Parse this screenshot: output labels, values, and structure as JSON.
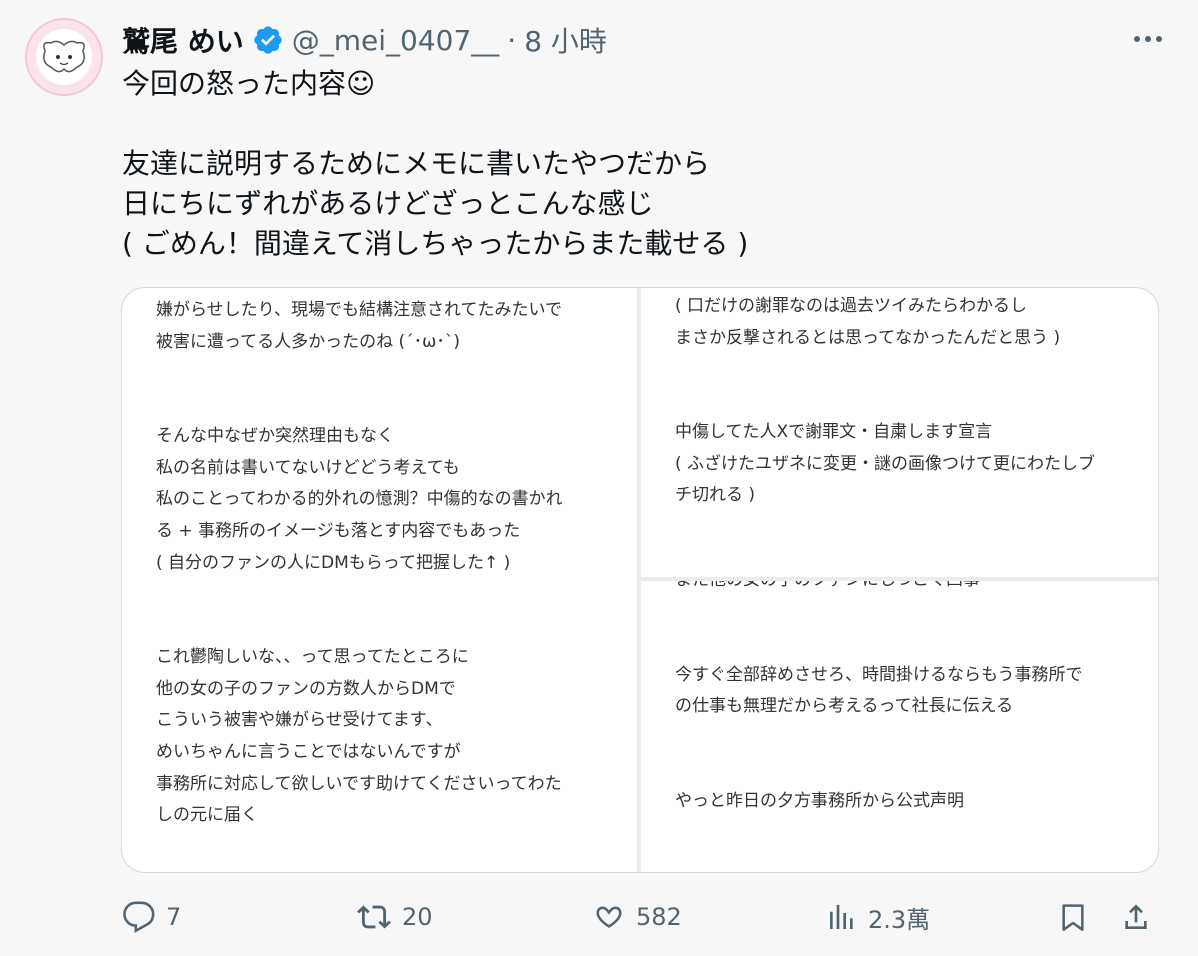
{
  "post": {
    "display_name": "鷲尾 めい",
    "handle": "@_mei_0407__",
    "separator": "·",
    "time": "8 小時",
    "lines": [
      "今回の怒った内容☺︎",
      "友達に説明するためにメモに書いたやつだから",
      "日にちにずれがあるけどざっとこんな感じ",
      "( ごめん！間違えて消しちゃったからまた載せる )"
    ]
  },
  "media": {
    "left": {
      "paragraphs": [
        [
          "嫌がらせしたり、現場でも結構注意されてたみたいで",
          "被害に遭ってる人多かったのね (´･ω･`)"
        ],
        [
          "そんな中なぜか突然理由もなく",
          "私の名前は書いてないけどどう考えても",
          "私のことってわかる的外れの憶測？中傷的なの書かれ",
          "る + 事務所のイメージも落とす内容でもあった",
          "( 自分のファンの人にDMもらって把握した↑ )"
        ],
        [
          "これ鬱陶しいな、、って思ってたところに",
          "他の女の子のファンの方数人からDMで",
          "こういう被害や嫌がらせ受けてます、",
          "めいちゃんに言うことではないんですが",
          "事務所に対応して欲しいです助けてくださいってわた",
          "しの元に届く"
        ]
      ]
    },
    "right_top": {
      "paragraphs": [
        [
          "( 口だけの謝罪なのは過去ツイみたらわかるし",
          "まさか反撃されるとは思ってなかったんだと思う )"
        ],
        [
          "中傷してた人Xで謝罪文・自粛します宣言",
          "( ふざけたユザネに変更・謎の画像つけて更にわたしブ",
          "チ切れる )"
        ]
      ]
    },
    "right_bottom": {
      "cut_line": "また他の女の子のファンにしつこく凸事",
      "paragraphs": [
        [
          "今すぐ全部辞めさせろ、時間掛けるならもう事務所で",
          "の仕事も無理だから考えるって社長に伝える"
        ],
        [
          "やっと昨日の夕方事務所から公式声明"
        ]
      ]
    }
  },
  "actions": {
    "reply_count": "7",
    "retweet_count": "20",
    "like_count": "582",
    "view_count": "2.3萬"
  },
  "colors": {
    "verified": "#1d9bf0",
    "muted": "#536471",
    "text": "#0f1419"
  },
  "icons": [
    "verified-badge-icon",
    "more-icon",
    "reply-icon",
    "retweet-icon",
    "like-icon",
    "views-icon",
    "bookmark-icon",
    "share-icon"
  ]
}
